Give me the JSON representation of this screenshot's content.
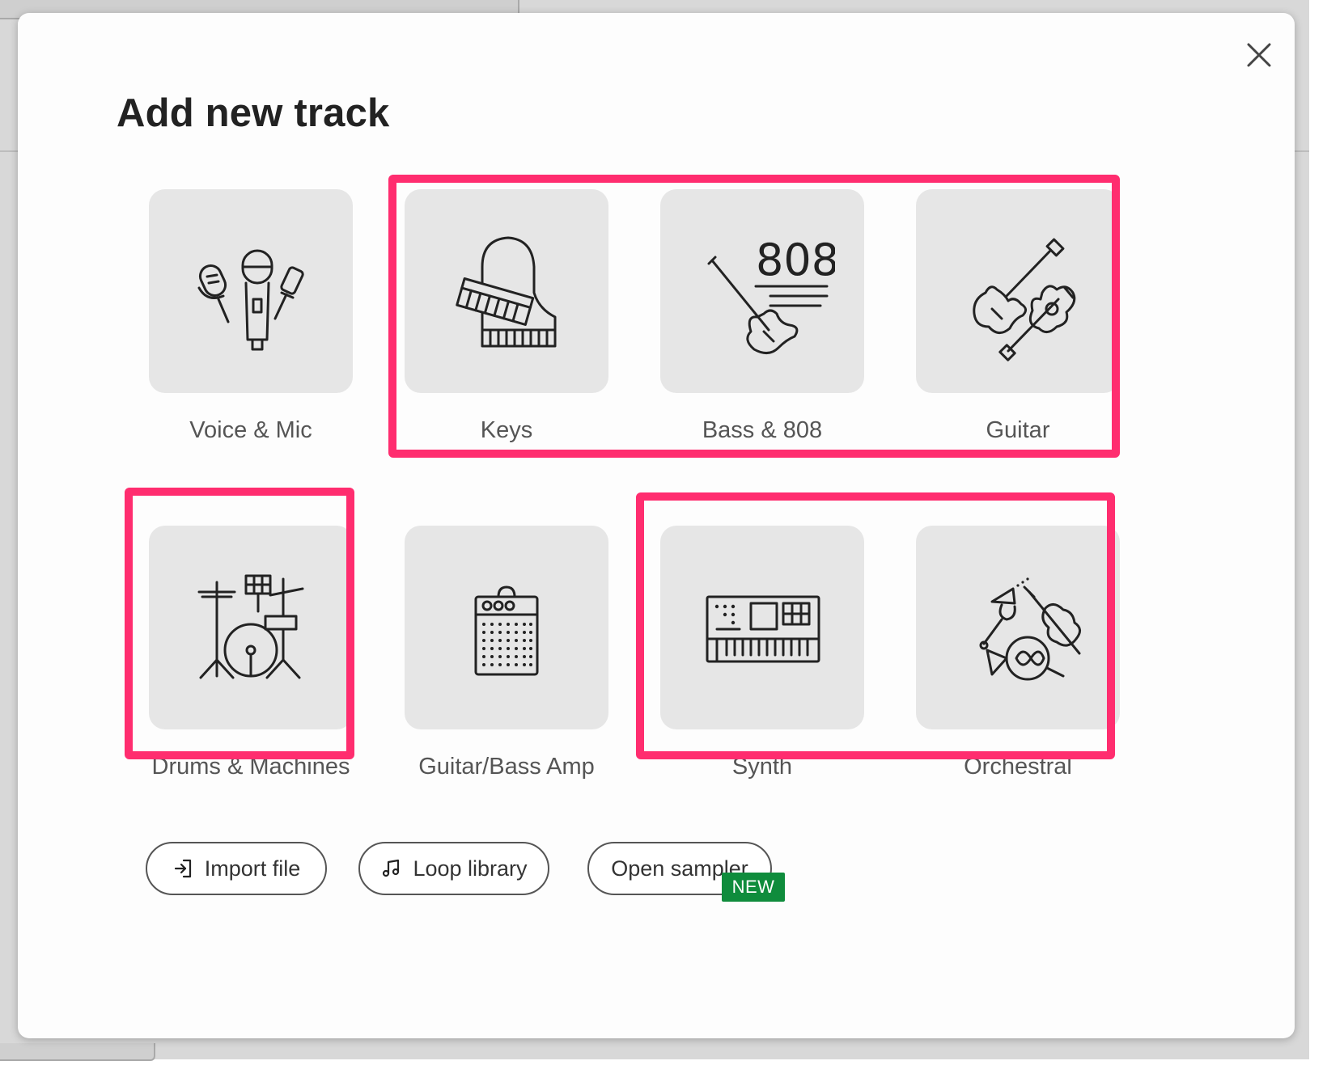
{
  "dialog": {
    "title": "Add new track",
    "close_icon": "close-icon"
  },
  "tracks": [
    {
      "label": "Voice & Mic",
      "icon": "microphones-icon"
    },
    {
      "label": "Keys",
      "icon": "piano-icon"
    },
    {
      "label": "Bass & 808",
      "icon": "bass-808-icon"
    },
    {
      "label": "Guitar",
      "icon": "guitars-icon"
    },
    {
      "label": "Drums & Machines",
      "icon": "drum-kit-icon"
    },
    {
      "label": "Guitar/Bass Amp",
      "icon": "amplifier-icon"
    },
    {
      "label": "Synth",
      "icon": "synthesizer-icon"
    },
    {
      "label": "Orchestral",
      "icon": "orchestral-instruments-icon"
    }
  ],
  "actions": {
    "import_label": "Import file",
    "loop_label": "Loop library",
    "sampler_label": "Open sampler",
    "sampler_badge": "NEW"
  },
  "colors": {
    "highlight": "#ff2d6f",
    "badge": "#0f8c3c",
    "tile": "#e6e6e6"
  },
  "text_808": "808"
}
